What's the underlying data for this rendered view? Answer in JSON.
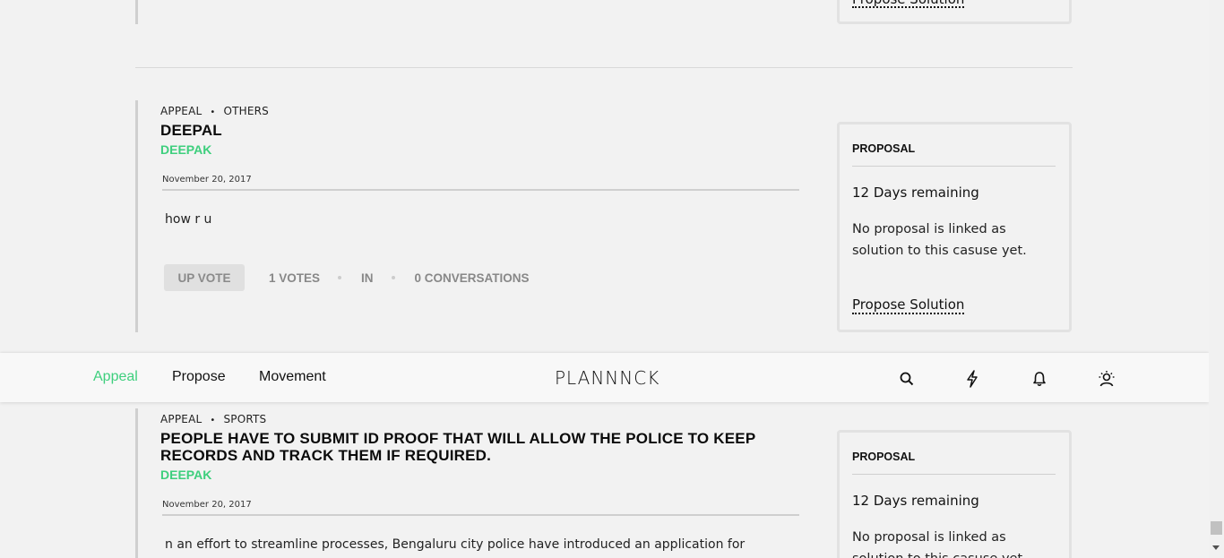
{
  "previous_post": {
    "propose_label": "Propose Solution"
  },
  "posts": [
    {
      "category": "APPEAL",
      "subcategory": "OTHERS",
      "title": "DEEPAL",
      "author": "DEEPAK",
      "date": "November 20, 2017",
      "body": "how r u",
      "upvote_label": "UP VOTE",
      "votes": "1 VOTES",
      "in_label": "IN",
      "conversations": "0 CONVERSATIONS",
      "proposal": {
        "heading": "PROPOSAL",
        "days_remaining": "12 Days remaining",
        "note": "No proposal is linked as solution to this casuse yet.",
        "link": "Propose Solution"
      }
    },
    {
      "category": "APPEAL",
      "subcategory": "SPORTS",
      "title": "PEOPLE HAVE TO SUBMIT ID PROOF THAT WILL ALLOW THE POLICE TO KEEP RECORDS AND TRACK THEM IF REQUIRED.",
      "author": "DEEPAK",
      "date": "November 20, 2017",
      "body": "n an effort to streamline processes, Bengaluru city police have introduced an application for",
      "proposal": {
        "heading": "PROPOSAL",
        "days_remaining": "12 Days remaining",
        "note": "No proposal is linked as solution to this casuse yet."
      }
    }
  ],
  "nav": {
    "items": [
      "Appeal",
      "Propose",
      "Movement"
    ],
    "active": "Appeal",
    "logo": "PLANNNCK",
    "icons": [
      "search-icon",
      "lightning-icon",
      "bell-icon",
      "user-icon"
    ]
  },
  "colors": {
    "accent": "#3ecf7d",
    "background": "#f2f2f2"
  }
}
